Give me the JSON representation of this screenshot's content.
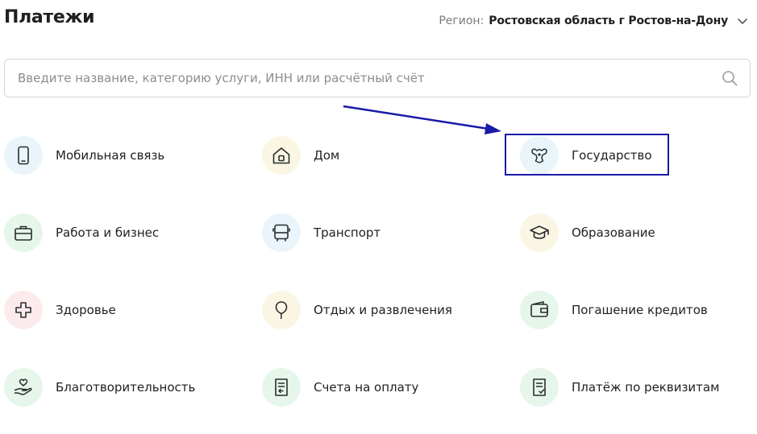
{
  "header": {
    "title": "Платежи",
    "region_label": "Регион:",
    "region_value": "Ростовская область г Ростов-на-Дону"
  },
  "search": {
    "placeholder": "Введите название, категорию услуги, ИНН или расчётный счёт",
    "value": ""
  },
  "categories": [
    {
      "label": "Мобильная связь",
      "icon": "mobile-phone-icon"
    },
    {
      "label": "Дом",
      "icon": "house-icon"
    },
    {
      "label": "Государство",
      "icon": "government-emblem-icon"
    },
    {
      "label": "Работа и бизнес",
      "icon": "briefcase-icon"
    },
    {
      "label": "Транспорт",
      "icon": "bus-icon"
    },
    {
      "label": "Образование",
      "icon": "graduation-cap-icon"
    },
    {
      "label": "Здоровье",
      "icon": "medical-cross-icon"
    },
    {
      "label": "Отдых и развлечения",
      "icon": "balloon-icon"
    },
    {
      "label": "Погашение кредитов",
      "icon": "wallet-icon"
    },
    {
      "label": "Благотворительность",
      "icon": "charity-heart-hand-icon"
    },
    {
      "label": "Счета на оплату",
      "icon": "invoice-icon"
    },
    {
      "label": "Платёж по реквизитам",
      "icon": "document-check-icon"
    }
  ],
  "annotation": {
    "highlighted_item": "Государство",
    "color": "#1a1aa8"
  },
  "colors": {
    "icon_bg_blue": "#e9f5fb",
    "icon_bg_yellow": "#fbf6e4",
    "icon_bg_green": "#e6f6ea",
    "icon_bg_pink": "#fcebed",
    "icon_stroke": "#2b2d30"
  }
}
